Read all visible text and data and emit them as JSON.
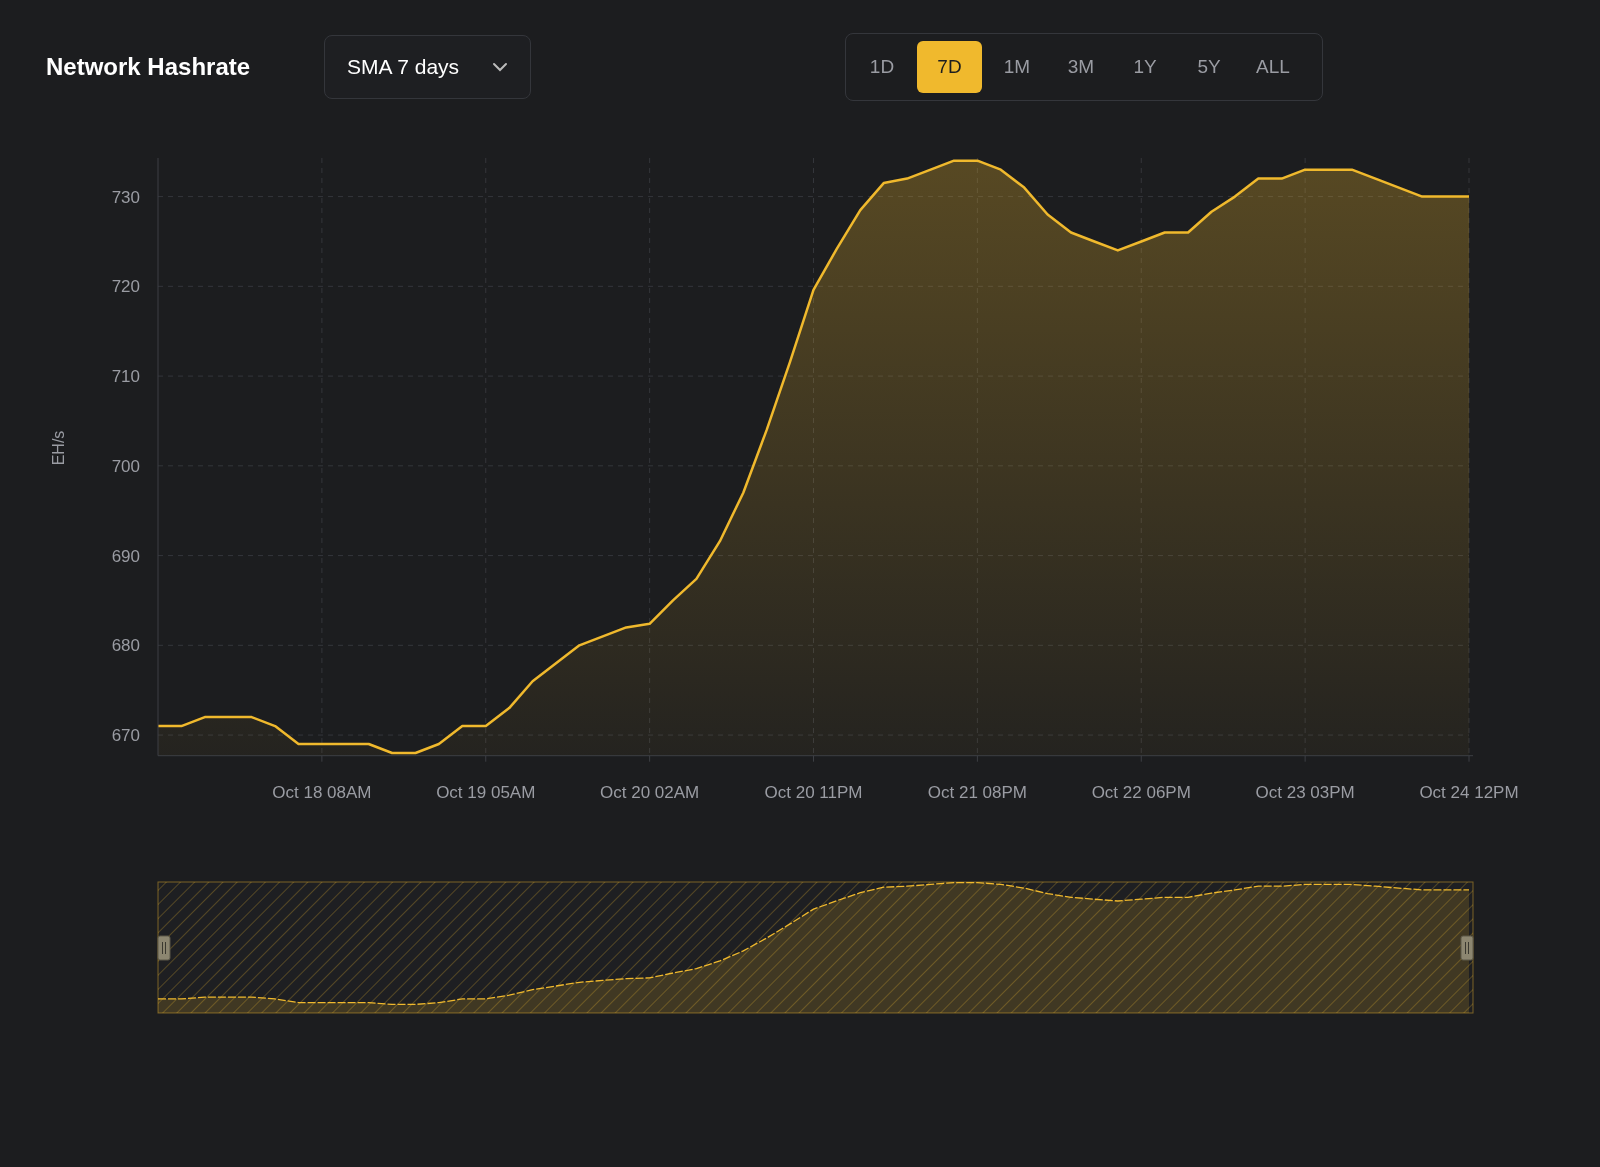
{
  "header": {
    "title": "Network Hashrate",
    "dropdown": {
      "value": "SMA 7 days"
    },
    "tabs": [
      {
        "label": "1D",
        "selected": false
      },
      {
        "label": "7D",
        "selected": true
      },
      {
        "label": "1M",
        "selected": false
      },
      {
        "label": "3M",
        "selected": false
      },
      {
        "label": "1Y",
        "selected": false
      },
      {
        "label": "5Y",
        "selected": false
      },
      {
        "label": "ALL",
        "selected": false
      }
    ]
  },
  "chart": {
    "chart_data": {
      "type": "area",
      "grid": true,
      "ylabel": "EH/s",
      "categories": [
        null,
        null,
        null,
        null,
        null,
        null,
        null,
        "Oct 18 08AM",
        null,
        null,
        null,
        null,
        null,
        null,
        "Oct 19 05AM",
        null,
        null,
        null,
        null,
        null,
        null,
        "Oct 20 02AM",
        null,
        null,
        null,
        null,
        null,
        null,
        "Oct 20 11PM",
        null,
        null,
        null,
        null,
        null,
        null,
        "Oct 21 08PM",
        null,
        null,
        null,
        null,
        null,
        null,
        "Oct 22 06PM",
        null,
        null,
        null,
        null,
        null,
        null,
        "Oct 23 03PM",
        null,
        null,
        null,
        null,
        null,
        null,
        "Oct 24 12PM"
      ],
      "series": [
        {
          "color": "#f0b92d",
          "values": [
            671,
            671,
            672,
            672,
            672,
            671,
            669,
            669,
            669,
            669,
            668,
            668,
            669,
            671,
            671,
            673,
            676,
            678,
            680,
            681,
            682,
            682.4,
            685,
            687.4,
            691.6,
            697,
            704,
            711.6,
            719.6,
            724.2,
            728.5,
            731.5,
            732,
            733,
            734,
            734,
            733,
            731,
            728,
            726,
            725,
            724,
            725,
            726,
            726,
            728.3,
            730,
            732,
            732,
            733,
            733,
            733,
            732,
            731,
            730,
            730,
            730
          ]
        }
      ],
      "ylim": [
        667.7,
        734.3
      ],
      "yticks": [
        670,
        680,
        690,
        700,
        710,
        720,
        730
      ]
    }
  }
}
